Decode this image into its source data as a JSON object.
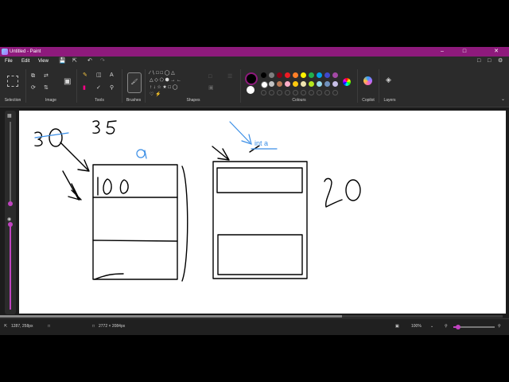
{
  "window": {
    "title": "Untitled - Paint"
  },
  "menu": {
    "file": "File",
    "edit": "Edit",
    "view": "View"
  },
  "ribbon": {
    "groups": {
      "selection": "Selection",
      "image": "Image",
      "tools": "Tools",
      "brushes": "Brushes",
      "shapes": "Shapes",
      "colours": "Colours",
      "copilot": "Copilot",
      "layers": "Layers"
    },
    "palette_row1": [
      "#000000",
      "#7f7f7f",
      "#880015",
      "#ed1c24",
      "#ff7f27",
      "#fff200",
      "#22b14c",
      "#00a2e8",
      "#3f48cc",
      "#a349a4"
    ],
    "palette_row2": [
      "#ffffff",
      "#c3c3c3",
      "#b97a57",
      "#ffaec9",
      "#ffc90e",
      "#efe4b0",
      "#b5e61d",
      "#99d9ea",
      "#7092be",
      "#c8bfe7"
    ]
  },
  "canvas": {
    "annotations": {
      "number_30": "30",
      "number_35": "35",
      "number_100": "100",
      "number_20": "20",
      "label_a": "a",
      "label_int_a": "int a"
    },
    "ink_color": "#000000",
    "highlight_color": "#3a8ee6"
  },
  "status": {
    "cursor_pos": "1287, 258px",
    "canvas_size": "2772 × 2084px",
    "zoom": "100%"
  }
}
